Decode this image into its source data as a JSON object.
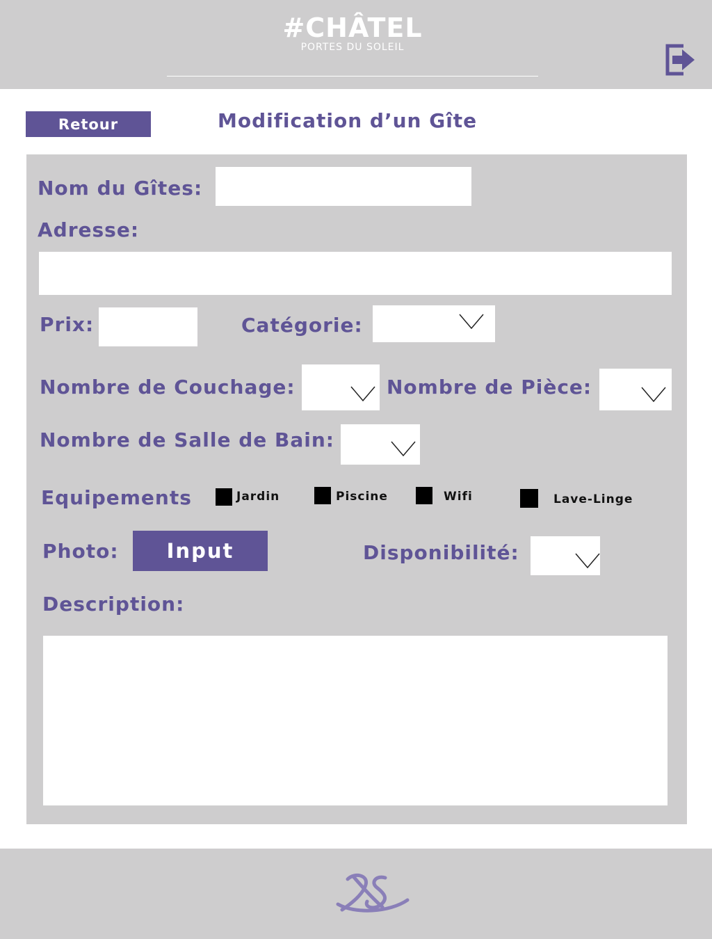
{
  "header": {
    "logo_main": "#CHÂTEL",
    "logo_sub": "PORTES DU SOLEIL",
    "logout_icon": "logout-icon"
  },
  "nav": {
    "back_label": "Retour"
  },
  "page": {
    "title": "Modification d’un Gîte"
  },
  "form": {
    "name_label": "Nom du Gîtes:",
    "name_value": "",
    "address_label": "Adresse:",
    "address_value": "",
    "price_label": "Prix:",
    "price_value": "",
    "category_label": "Catégorie:",
    "category_value": "",
    "beds_label": "Nombre de Couchage:",
    "beds_value": "",
    "rooms_label": "Nombre de Pièce:",
    "rooms_value": "",
    "bathrooms_label": "Nombre de Salle de Bain:",
    "bathrooms_value": "",
    "equipment_label": "Equipements",
    "equipment": [
      {
        "label": "Jardin",
        "checked": true
      },
      {
        "label": "Piscine",
        "checked": true
      },
      {
        "label": "Wifi",
        "checked": true
      },
      {
        "label": "Lave-Linge",
        "checked": true
      }
    ],
    "photo_label": "Photo:",
    "photo_button": "Input",
    "availability_label": "Disponibilité:",
    "availability_value": "",
    "description_label": "Description:",
    "description_value": ""
  },
  "footer": {
    "logo_icon": "xs-monogram-logo"
  },
  "colors": {
    "accent": "#5f5496",
    "panel": "#cecdce",
    "header_bg": "#cecdce",
    "field_bg": "#ffffff",
    "checkbox": "#000000"
  }
}
